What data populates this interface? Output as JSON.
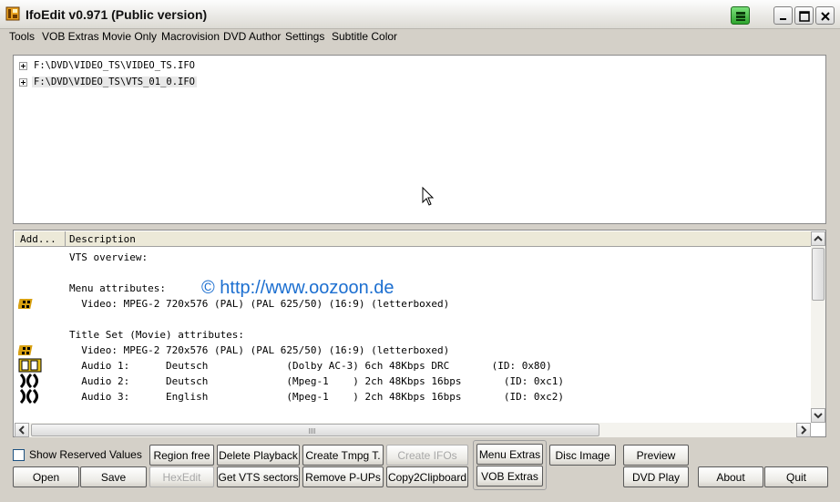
{
  "window": {
    "title": "IfoEdit v0.971 (Public version)"
  },
  "menu": [
    {
      "label": "Tools"
    },
    {
      "label": "VOB Extras"
    },
    {
      "label": "Movie Only"
    },
    {
      "label": "Macrovision"
    },
    {
      "label": "DVD Author"
    },
    {
      "label": "Settings"
    },
    {
      "label": "Subtitle Color"
    }
  ],
  "tree": [
    {
      "label": "F:\\DVD\\VIDEO_TS\\VIDEO_TS.IFO",
      "selected": false
    },
    {
      "label": "F:\\DVD\\VIDEO_TS\\VTS_01_0.IFO",
      "selected": true
    }
  ],
  "list": {
    "columns": [
      "Add...",
      "Description"
    ],
    "watermark": "© http://www.oozoon.de",
    "rows": [
      {
        "icon": "",
        "text": "VTS overview:"
      },
      {
        "icon": "",
        "text": ""
      },
      {
        "icon": "",
        "text": "Menu attributes:"
      },
      {
        "icon": "film-icon",
        "text": "  Video: MPEG-2 720x576 (PAL) (PAL 625/50) (16:9) (letterboxed)"
      },
      {
        "icon": "",
        "text": ""
      },
      {
        "icon": "",
        "text": "Title Set (Movie) attributes:"
      },
      {
        "icon": "film-icon",
        "text": "  Video: MPEG-2 720x576 (PAL) (PAL 625/50) (16:9) (letterboxed)"
      },
      {
        "icon": "dolby-icon",
        "text": "  Audio 1:      Deutsch             (Dolby AC-3) 6ch 48Kbps DRC       (ID: 0x80)"
      },
      {
        "icon": "mpeg-audio-icon",
        "text": "  Audio 2:      Deutsch             (Mpeg-1    ) 2ch 48Kbps 16bps       (ID: 0xc1)"
      },
      {
        "icon": "mpeg-audio-icon",
        "text": "  Audio 3:      English             (Mpeg-1    ) 2ch 48Kbps 16bps       (ID: 0xc2)"
      }
    ]
  },
  "controls": {
    "show_reserved": "Show Reserved Values",
    "open": "Open",
    "save": "Save",
    "region_free": "Region free",
    "hexedit": "HexEdit",
    "delete_playback": "Delete Playback",
    "get_vts_sectors": "Get VTS sectors",
    "create_tmpg": "Create Tmpg T.",
    "remove_pups": "Remove P-UPs",
    "create_ifos": "Create IFOs",
    "copy2clipboard": "Copy2Clipboard",
    "menu_extras": "Menu Extras",
    "vob_extras": "VOB Extras",
    "disc_image": "Disc Image",
    "preview": "Preview",
    "dvd_play": "DVD Play",
    "about": "About",
    "quit": "Quit"
  },
  "colors": {
    "window_bg": "#d4d0c8",
    "watermark": "#1c6fd0",
    "green_button": "#2fa52f"
  }
}
